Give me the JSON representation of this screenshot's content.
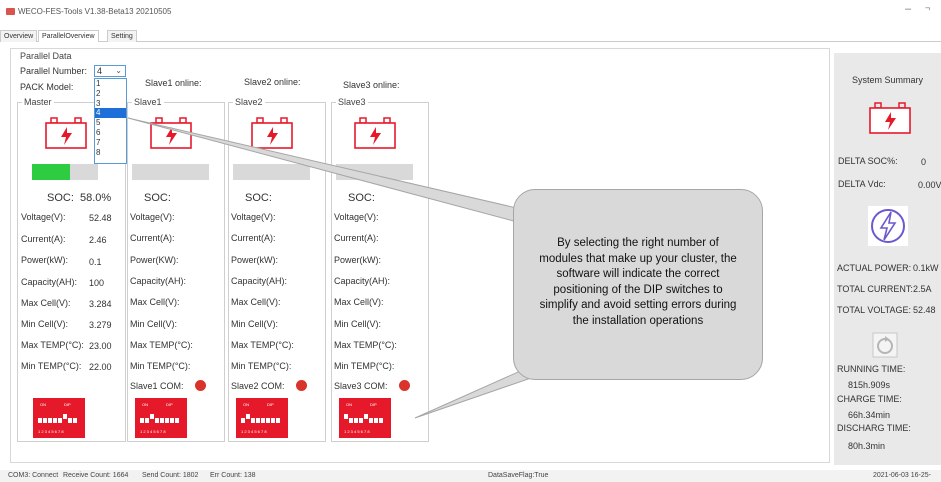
{
  "window": {
    "title": "WECO-FES-Tools V1.38-Beta13 20210505",
    "min": "–",
    "max": "¬"
  },
  "tabs": [
    {
      "label": "Overview"
    },
    {
      "label": "ParallelOverview"
    },
    {
      "label": "Setting"
    }
  ],
  "parallel": {
    "group_title": "Parallel Data",
    "number_label": "Parallel Number:",
    "number_value": "4",
    "pack_model_label": "PACK Model:",
    "options": [
      "1",
      "2",
      "3",
      "4",
      "5",
      "6",
      "7",
      "8"
    ]
  },
  "online_labels": [
    "Slave1 online:",
    "Slave2 online:",
    "Slave3 online:"
  ],
  "field_labels": {
    "voltage": "Voltage(V):",
    "current": "Current(A):",
    "power": "Power(kW):",
    "capacity": "Capacity(AH):",
    "max_cell": "Max Cell(V):",
    "min_cell": "Min Cell(V):",
    "max_temp": "Max TEMP(°C):",
    "min_temp": "Min TEMP(°C):"
  },
  "master": {
    "title": "Master",
    "soc_label": "SOC:",
    "soc_value": "58.0%",
    "soc_fraction": 0.58,
    "voltage": "52.48",
    "current": "2.46",
    "power": "0.1",
    "capacity": "100",
    "max_cell": "3.284",
    "min_cell": "3.279",
    "max_temp": "23.00",
    "min_temp": "22.00",
    "dip_on": "ON",
    "dip_label": "DIP",
    "dip_numbers": "1 2 3 4 5 6 7 8"
  },
  "slaves": [
    {
      "title": "Slave1",
      "soc_label": "SOC:",
      "power_label": "Power(KW):",
      "com_label": "Slave1 COM:"
    },
    {
      "title": "Slave2",
      "soc_label": "SOC:",
      "power_label": "Power(kW):",
      "com_label": "Slave2 COM:"
    },
    {
      "title": "Slave3",
      "soc_label": "SOC:",
      "power_label": "Power(kW):",
      "com_label": "Slave3 COM:"
    }
  ],
  "dip": {
    "on": "ON",
    "label": "DIP",
    "numbers": "1 2 3 4 5 6 7 8"
  },
  "callout": "By selecting the right number of modules that make up your cluster, the software will indicate the correct positioning of the DIP switches to simplify and avoid setting errors during the installation operations",
  "summary": {
    "title": "System Summary",
    "delta_soc_label": "DELTA SOC%:",
    "delta_soc_value": "0",
    "delta_vdc_label": "DELTA Vdc:",
    "delta_vdc_value": "0.00V",
    "actual_power_label": "ACTUAL POWER:",
    "actual_power_value": "0.1kW",
    "total_current_label": "TOTAL CURRENT:",
    "total_current_value": "2.5A",
    "total_voltage_label": "TOTAL VOLTAGE:",
    "total_voltage_value": "52.48",
    "running_time_label": "RUNNING TIME:",
    "running_time_value": "815h.909s",
    "charge_time_label": "CHARGE TIME:",
    "charge_time_value": "66h.34min",
    "discharge_time_label": "DISCHARG TIME:",
    "discharge_time_value": "80h.3min"
  },
  "status": {
    "com": "COM3: Connect",
    "receive": "Receive Count: 1664",
    "send": "Send Count: 1802",
    "err": "Err Count: 138",
    "flag": "DataSaveFlag:True",
    "datetime": "2021-06-03 16-25-"
  },
  "colors": {
    "accent_red": "#e6192b",
    "soc_green": "#2ecc40",
    "selection_blue": "#1e6fd9"
  }
}
